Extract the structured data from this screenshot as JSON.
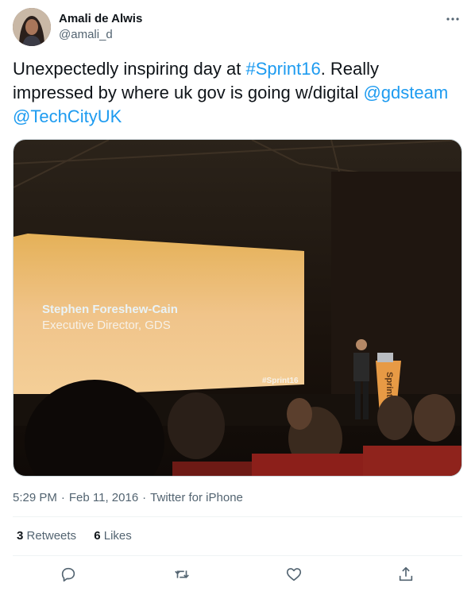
{
  "author": {
    "display_name": "Amali de Alwis",
    "handle": "@amali_d"
  },
  "tweet": {
    "text_prefix": "Unexpectedly inspiring day at ",
    "hashtag": "#Sprint16",
    "text_middle": ". Really impressed by where uk gov is going w/digital ",
    "mention_1": "@gdsteam",
    "mention_2": "@TechCityUK"
  },
  "media": {
    "slide_name": "Stephen Foreshew-Cain",
    "slide_title": "Executive Director, GDS",
    "slide_hashtag": "#Sprint16",
    "lectern_label": "Sprint"
  },
  "meta": {
    "time": "5:29 PM",
    "date": "Feb 11, 2016",
    "source": "Twitter for iPhone",
    "separator": "·"
  },
  "stats": {
    "retweets_count": "3",
    "retweets_label": "Retweets",
    "likes_count": "6",
    "likes_label": "Likes"
  },
  "icons": {
    "more": "more-horizontal-icon",
    "reply": "reply-icon",
    "retweet": "retweet-icon",
    "like": "heart-icon",
    "share": "share-icon"
  },
  "colors": {
    "link": "#1d9bf0",
    "secondary_text": "#536471",
    "icon": "#536471"
  }
}
